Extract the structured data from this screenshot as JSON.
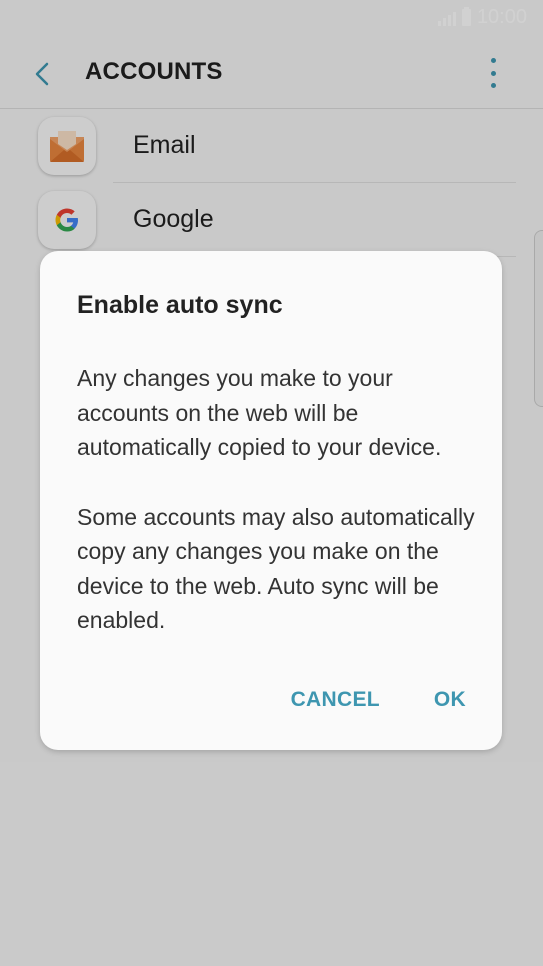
{
  "status_bar": {
    "time": "10:00"
  },
  "app_bar": {
    "title": "ACCOUNTS"
  },
  "accounts": [
    {
      "label": "Email",
      "icon": "email-envelope-icon"
    },
    {
      "label": "Google",
      "icon": "google-g-icon"
    }
  ],
  "dialog": {
    "title": "Enable auto sync",
    "paragraphs": [
      "Any changes you make to your accounts on the web will be automatically copied to your device.",
      "Some accounts may also automatically copy any changes you make on the device to the web. Auto sync will be enabled."
    ],
    "cancel_label": "CANCEL",
    "ok_label": "OK"
  },
  "colors": {
    "accent": "#3e96b0",
    "background": "#f6f6f6",
    "dialog_background": "#fafafa",
    "email_icon": "#e9873f"
  }
}
